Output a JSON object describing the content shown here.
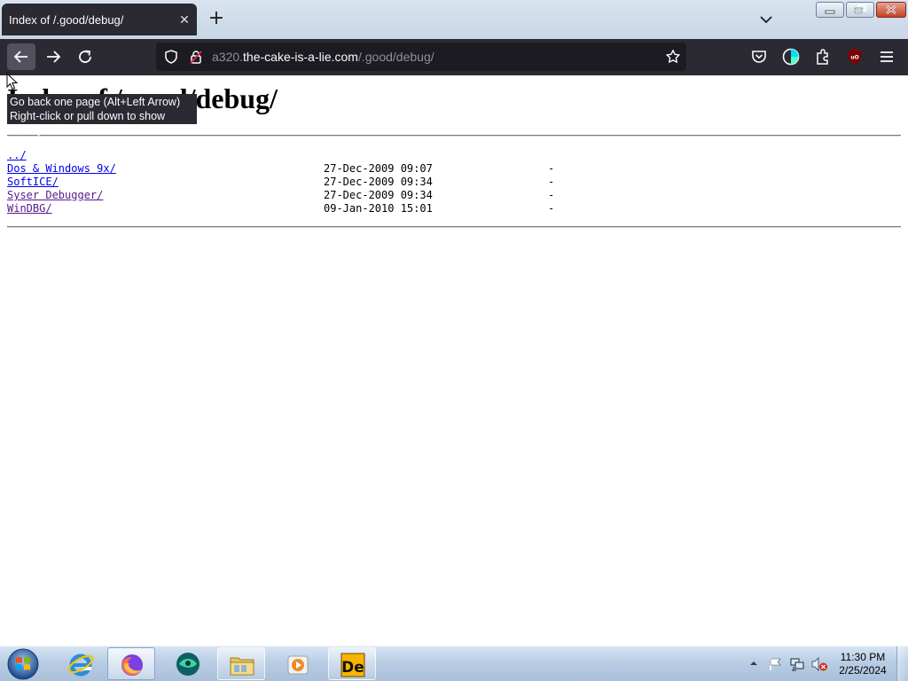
{
  "browser": {
    "tab": {
      "title": "Index of /.good/debug/",
      "close_icon": "close-icon"
    },
    "new_tab_label": "+",
    "url": {
      "prefix": "a320.",
      "domain": "the-cake-is-a-lie.com",
      "path": "/.good/debug/"
    }
  },
  "tooltip": {
    "line1": "Go back one page (Alt+Left Arrow)",
    "line2": "Right-click or pull down to show history"
  },
  "page": {
    "heading": "Index of /.good/debug/",
    "parent_link": "../",
    "entries": [
      {
        "name": "Dos & Windows 9x/",
        "date": "27-Dec-2009 09:07",
        "size": "-"
      },
      {
        "name": "SoftICE/",
        "date": "27-Dec-2009 09:34",
        "size": "-"
      },
      {
        "name": "Syser Debugger/",
        "date": "27-Dec-2009 09:34",
        "size": "-"
      },
      {
        "name": "WinDBG/",
        "date": "09-Jan-2010 15:01",
        "size": "-"
      }
    ]
  },
  "taskbar": {
    "apps": [
      "internet-explorer-icon",
      "firefox-icon",
      "app-icon",
      "file-explorer-icon",
      "media-player-icon",
      "de-app-icon"
    ],
    "clock": {
      "time": "11:30 PM",
      "date": "2/25/2024"
    },
    "tray": [
      "show-hidden-icons",
      "action-center-flag-icon",
      "network-icon",
      "volume-muted-icon"
    ]
  },
  "colors": {
    "browser_chrome": "#2b2a33",
    "url_field": "#1c1b22",
    "link": "#0000ee",
    "visited_link": "#551a8b"
  }
}
